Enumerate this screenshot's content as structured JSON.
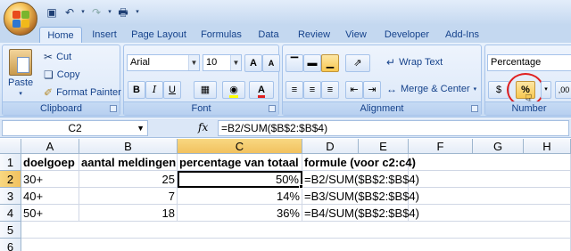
{
  "quick_access": [
    "save-icon",
    "undo-icon",
    "redo-icon",
    "print-preview-icon"
  ],
  "tabs": [
    "Home",
    "Insert",
    "Page Layout",
    "Formulas",
    "Data",
    "Review",
    "View",
    "Developer",
    "Add-Ins"
  ],
  "clipboard": {
    "paste": "Paste",
    "cut": "Cut",
    "copy": "Copy",
    "format_painter": "Format Painter",
    "label": "Clipboard"
  },
  "font": {
    "name": "Arial",
    "size": "10",
    "label": "Font",
    "bold": "B",
    "italic": "I",
    "underline": "U",
    "grow": "A",
    "shrink": "A",
    "font_color": "A"
  },
  "alignment": {
    "wrap_text": "Wrap Text",
    "merge_center": "Merge & Center",
    "label": "Alignment"
  },
  "number": {
    "format": "Percentage",
    "label": "Number",
    "percent": "%"
  },
  "formula_bar": {
    "name_box": "C2",
    "fx": "fx",
    "formula": "=B2/SUM($B$2:$B$4)"
  },
  "columns": [
    "A",
    "B",
    "C",
    "D",
    "E",
    "F",
    "G",
    "H"
  ],
  "rows": [
    "1",
    "2",
    "3",
    "4",
    "5",
    "6"
  ],
  "cells": {
    "r1": {
      "a": "doelgoep",
      "b": "aantal meldingen",
      "c": "percentage van totaal",
      "d": "formule (voor c2:c4)"
    },
    "r2": {
      "a": "30+",
      "b": "25",
      "c": "50%",
      "d": "=B2/SUM($B$2:$B$4)"
    },
    "r3": {
      "a": "40+",
      "b": "7",
      "c": "14%",
      "d": "=B3/SUM($B$2:$B$4)"
    },
    "r4": {
      "a": "50+",
      "b": "18",
      "c": "36%",
      "d": "=B4/SUM($B$2:$B$4)"
    }
  },
  "colors": {
    "selected_header": "#f8d881",
    "highlight_circle": "#e02020"
  }
}
